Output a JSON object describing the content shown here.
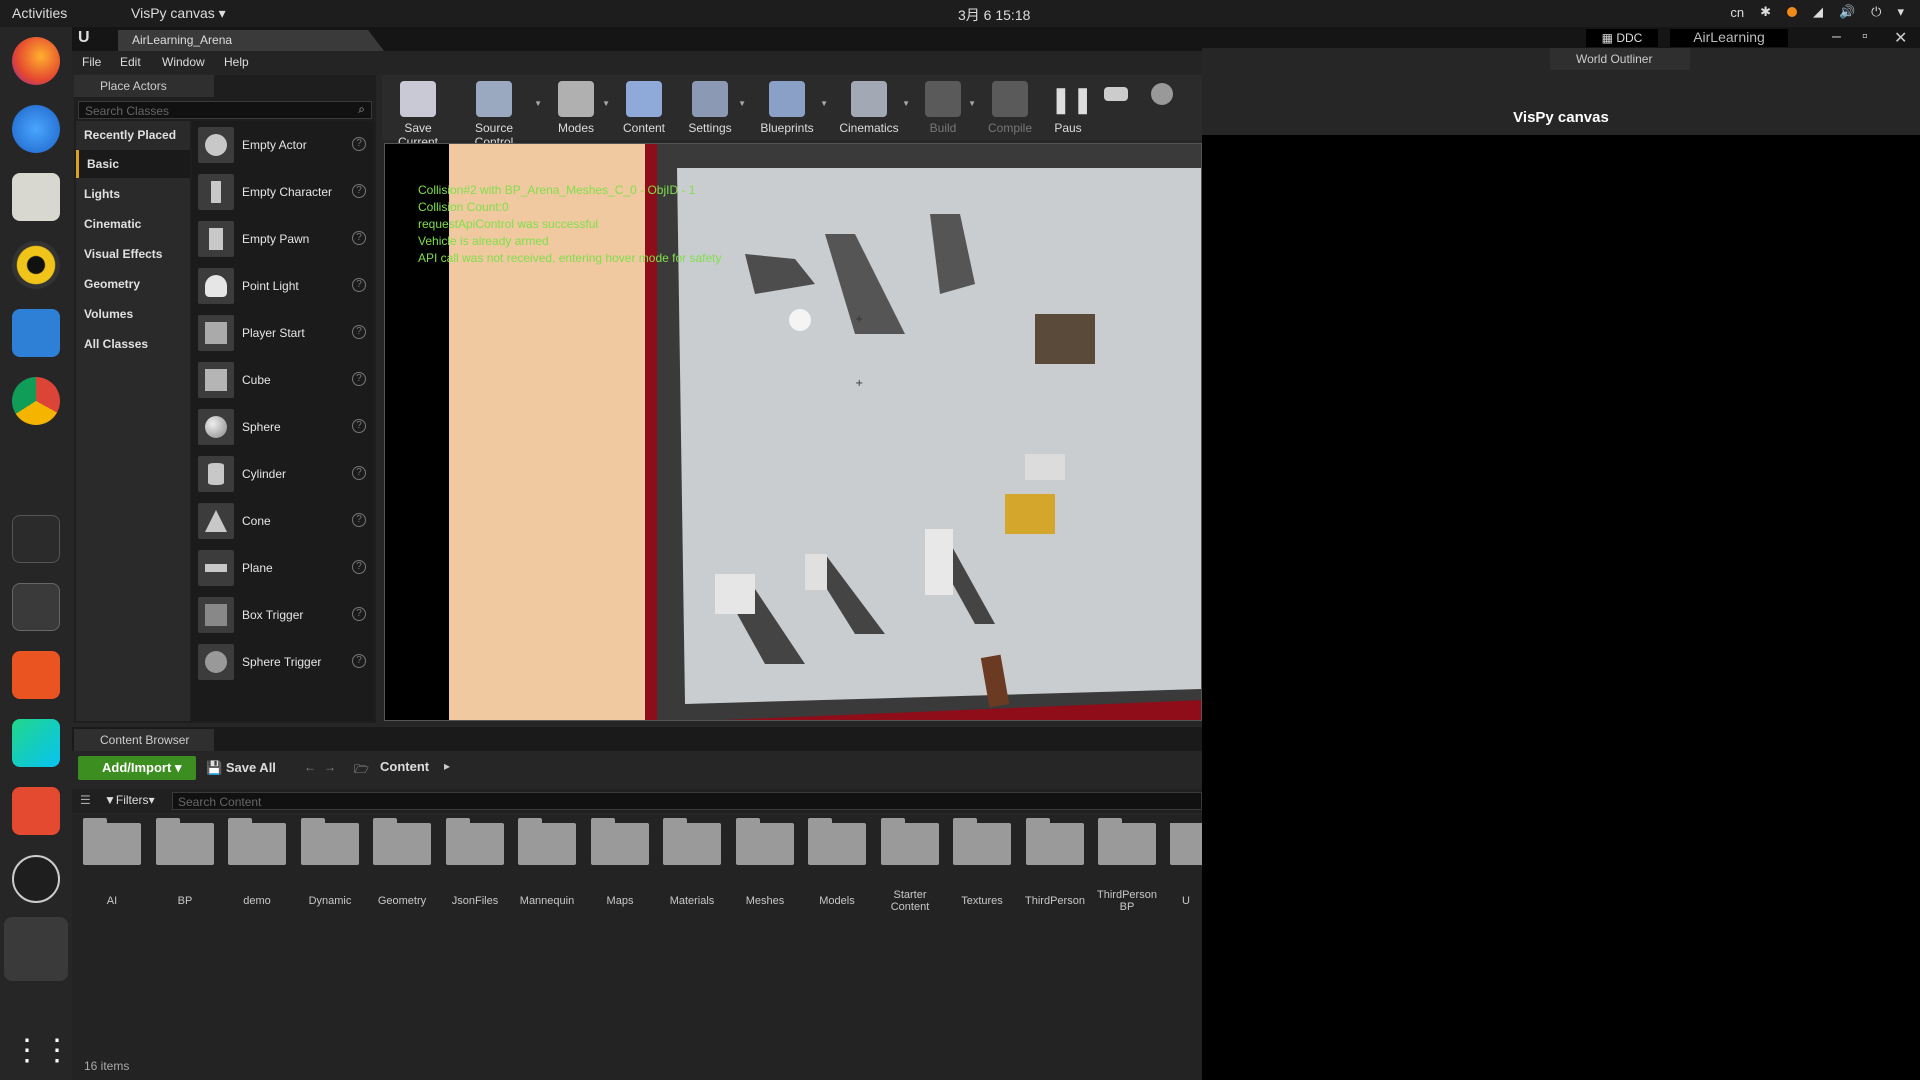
{
  "topbar": {
    "activities": "Activities",
    "app_menu": "VisPy canvas ▾",
    "clock": "3月 6  15:18",
    "input_method": "cn"
  },
  "dock": {
    "icons": [
      "firefox-icon",
      "thunderbird-icon",
      "files-icon",
      "rhythmbox-icon",
      "writer-icon",
      "chrome-icon",
      "system-monitor-icon",
      "terminal-icon",
      "software-center-icon",
      "pycharm-icon",
      "presentation-icon",
      "unreal-icon",
      "active-app-icon",
      "app-grid-icon"
    ]
  },
  "ue": {
    "tab_title": "AirLearning_Arena",
    "menu": [
      "File",
      "Edit",
      "Window",
      "Help"
    ],
    "ddc": "DDC",
    "project": "AirLearning",
    "place_actors": {
      "tab": "Place Actors",
      "search_placeholder": "Search Classes",
      "categories": [
        "Recently Placed",
        "Basic",
        "Lights",
        "Cinematic",
        "Visual Effects",
        "Geometry",
        "Volumes",
        "All Classes"
      ],
      "actors": [
        "Empty Actor",
        "Empty Character",
        "Empty Pawn",
        "Point Light",
        "Player Start",
        "Cube",
        "Sphere",
        "Cylinder",
        "Cone",
        "Plane",
        "Box Trigger",
        "Sphere Trigger"
      ]
    },
    "toolbar": [
      "Save Current",
      "Source Control",
      "Modes",
      "Content",
      "Settings",
      "Blueprints",
      "Cinematics",
      "Build",
      "Compile",
      "Paus"
    ],
    "viewport_log": [
      "Collision#2 with BP_Arena_Meshes_C_0 - ObjID - 1",
      "Collision Count:0",
      "requestApiControl was successful",
      "Vehicle is already armed",
      "API call was not received, entering hover mode for safety"
    ],
    "content_browser": {
      "tab": "Content Browser",
      "add_import": "Add/Import",
      "save_all": "Save All",
      "path": "Content",
      "filters": "Filters",
      "search_placeholder": "Search Content",
      "folders": [
        "AI",
        "BP",
        "demo",
        "Dynamic",
        "Geometry",
        "JsonFiles",
        "Mannequin",
        "Maps",
        "Materials",
        "Meshes",
        "Models",
        "Starter Content",
        "Textures",
        "ThirdPerson",
        "ThirdPerson BP",
        "U"
      ],
      "count": "16 items"
    },
    "world_outliner": "World Outliner"
  },
  "vispy": {
    "title": "VisPy canvas"
  },
  "colors": {
    "accent_green": "#3b8e1f",
    "debug_text": "#7fe04a",
    "arena_red": "#8e0d18",
    "floor": "#c9cdd0"
  }
}
